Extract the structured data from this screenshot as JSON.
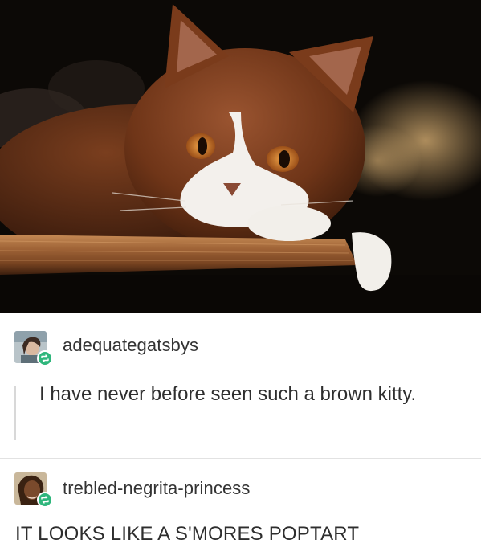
{
  "image": {
    "alt": "Brown and white cat resting its paws on a wooden shelf"
  },
  "posts": [
    {
      "username": "adequategatsbys",
      "text": "I have never before seen such a brown kitty.",
      "style": "quote"
    },
    {
      "username": "trebled-negrita-princess",
      "text": "IT LOOKS LIKE A S'MORES POPTART",
      "style": "plain"
    }
  ],
  "colors": {
    "reblog_badge": "#2fb67c",
    "cat_fur": "#7a3d1e",
    "shelf_wood": "#8a5530",
    "background": "#0c0906"
  },
  "icons": {
    "reblog": "reblog-icon"
  }
}
